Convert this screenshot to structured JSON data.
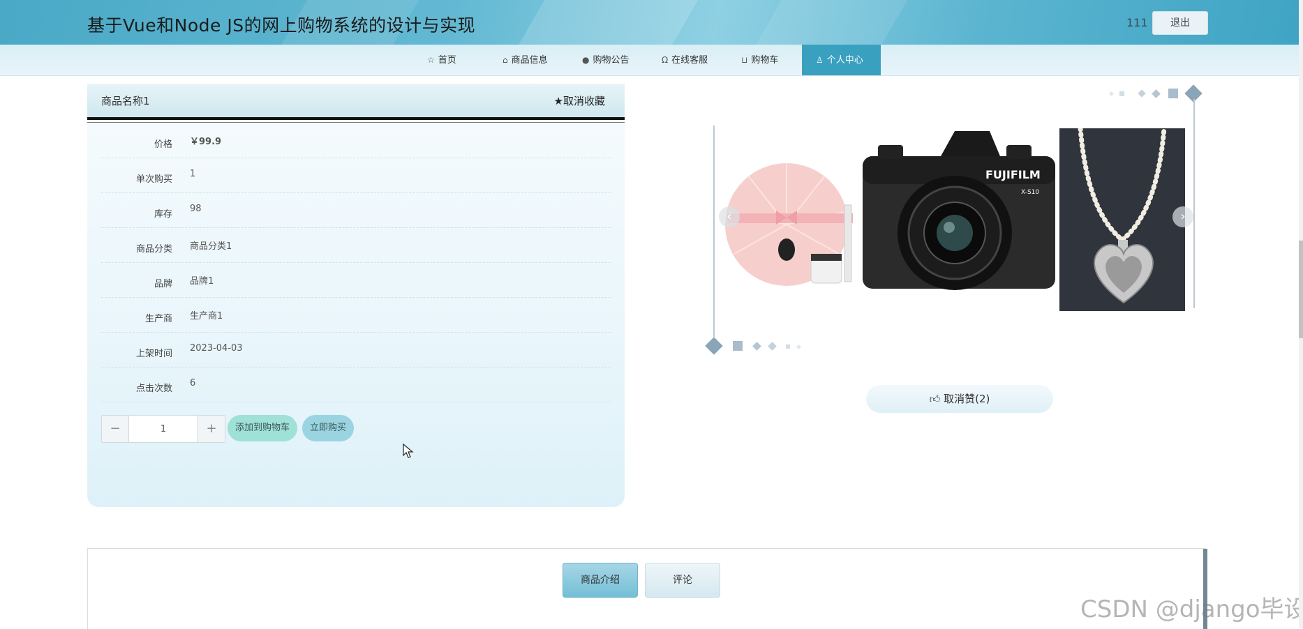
{
  "header": {
    "title": "基于Vue和Node JS的网上购物系统的设计与实现",
    "username": "111",
    "logout_label": "退出"
  },
  "nav": {
    "items": [
      {
        "label": "首页",
        "icon": "star-outline-icon"
      },
      {
        "label": "商品信息",
        "icon": "bag-icon"
      },
      {
        "label": "购物公告",
        "icon": "info-circle-icon"
      },
      {
        "label": "在线客服",
        "icon": "headset-icon"
      },
      {
        "label": "购物车",
        "icon": "cart-icon"
      },
      {
        "label": "个人中心",
        "icon": "user-icon"
      }
    ],
    "active_index": 5
  },
  "product": {
    "name": "商品名称1",
    "favorite_label": "取消收藏",
    "fields": [
      {
        "label": "价格",
        "value": "￥99.9"
      },
      {
        "label": "单次购买",
        "value": "1"
      },
      {
        "label": "库存",
        "value": "98"
      },
      {
        "label": "商品分类",
        "value": "商品分类1"
      },
      {
        "label": "品牌",
        "value": "品牌1"
      },
      {
        "label": "生产商",
        "value": "生产商1"
      },
      {
        "label": "上架时间",
        "value": "2023-04-03"
      },
      {
        "label": "点击次数",
        "value": "6"
      }
    ],
    "quantity": "1",
    "add_to_cart_label": "添加到购物车",
    "buy_now_label": "立即购买"
  },
  "gallery": {
    "images": [
      "cosmetics-image",
      "camera-image",
      "necklace-image"
    ],
    "camera_brand": "FUJIFILM",
    "camera_model": "X-S10"
  },
  "like": {
    "label": "取消赞(2)"
  },
  "tabs": {
    "items": [
      "商品介绍",
      "评论"
    ],
    "active_index": 0
  },
  "watermark": "CSDN @django毕设",
  "colors": {
    "header_accent": "#49a9c6",
    "nav_active": "#3aa0c0",
    "add_cart_button": "#9fe0d7",
    "buy_now_button": "#9ad4e0"
  }
}
